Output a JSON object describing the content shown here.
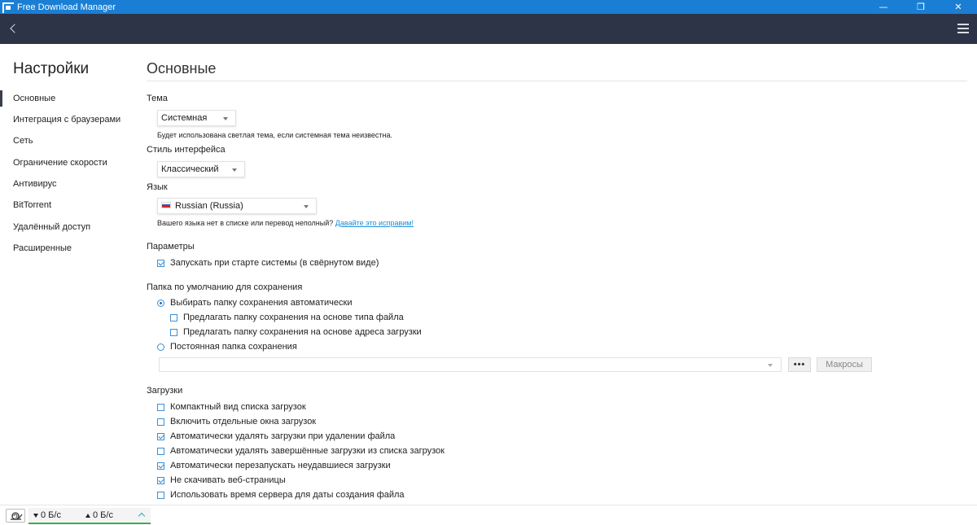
{
  "window": {
    "title": "Free Download Manager",
    "icons": {
      "logo": "fdm-logo-icon",
      "minimize": "minimize-icon",
      "restore": "restore-icon",
      "close": "close-icon"
    }
  },
  "toolbar": {
    "back_icon": "chevron-left-icon",
    "menu_icon": "hamburger-menu-icon"
  },
  "sidebar": {
    "title": "Настройки",
    "items": [
      {
        "label": "Основные",
        "active": true
      },
      {
        "label": "Интеграция с браузерами"
      },
      {
        "label": "Сеть"
      },
      {
        "label": "Ограничение скорости"
      },
      {
        "label": "Антивирус"
      },
      {
        "label": "BitTorrent"
      },
      {
        "label": "Удалённый доступ"
      },
      {
        "label": "Расширенные"
      }
    ]
  },
  "main": {
    "title": "Основные",
    "theme": {
      "label": "Тема",
      "value": "Системная",
      "hint": "Будет использована светлая тема, если системная тема неизвестна."
    },
    "ui_style": {
      "label": "Стиль интерфейса",
      "value": "Классический"
    },
    "language": {
      "label": "Язык",
      "value": "Russian (Russia)",
      "flag_icon": "russia-flag-icon",
      "hint": "Вашего языка нет в списке или перевод неполный?",
      "hint_link": "Давайте это исправим!"
    },
    "params": {
      "label": "Параметры",
      "autostart": {
        "label": "Запускать при старте системы (в свёрнутом виде)",
        "checked": true
      }
    },
    "save_folder": {
      "label": "Папка по умолчанию для сохранения",
      "auto": {
        "label": "Выбирать папку сохранения автоматически",
        "selected": true
      },
      "by_type": {
        "label": "Предлагать папку сохранения на основе типа файла",
        "checked": false
      },
      "by_url": {
        "label": "Предлагать папку сохранения на основе адреса загрузки",
        "checked": false
      },
      "fixed": {
        "label": "Постоянная папка сохранения",
        "selected": false
      },
      "path_value": "",
      "browse_label": "•••",
      "macros_label": "Макросы"
    },
    "downloads": {
      "label": "Загрузки",
      "items": [
        {
          "label": "Компактный вид списка загрузок",
          "checked": false
        },
        {
          "label": "Включить отдельные окна загрузок",
          "checked": false
        },
        {
          "label": "Автоматически удалять загрузки при удалении файла",
          "checked": true
        },
        {
          "label": "Автоматически удалять завершённые загрузки из списка загрузок",
          "checked": false
        },
        {
          "label": "Автоматически перезапускать неудавшиеся загрузки",
          "checked": true
        },
        {
          "label": "Не скачивать веб-страницы",
          "checked": true
        },
        {
          "label": "Использовать время сервера для даты создания файла",
          "checked": false
        }
      ]
    }
  },
  "statusbar": {
    "snail_icon": "snail-icon",
    "download_speed": "0 Б/с",
    "upload_speed": "0 Б/с",
    "expand_icon": "chevron-up-icon",
    "accent_color": "#2fb34a"
  }
}
